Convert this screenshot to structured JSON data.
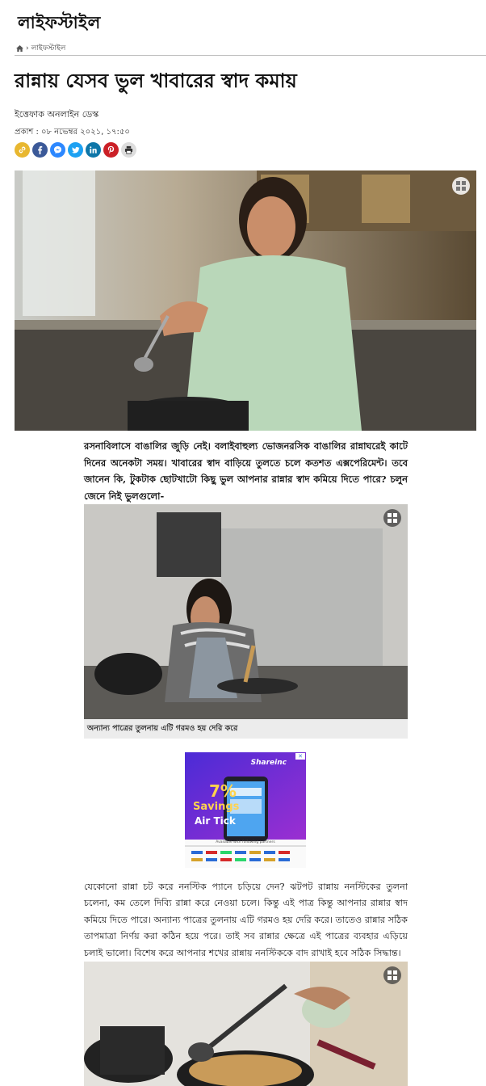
{
  "section": {
    "title": "লাইফস্টাইল"
  },
  "breadcrumb": {
    "label": "লাইফস্টাইল"
  },
  "article": {
    "headline": "রান্নায় যেসব ভুল খাবারের স্বাদ কমায়",
    "author": "ইত্তেফাক অনলাইন ডেস্ক",
    "published": "প্রকাশ : ০৮ নভেম্বর ২০২১, ১৭:৫০",
    "intro": "রসনাবিলাসে বাঙালির জুড়ি নেই। বলাইবাহুল্য ভোজনরসিক বাঙালির রান্নাঘরেই কাটে দিনের অনেকটা সময়। খাবারের স্বাদ বাড়িয়ে তুলতে চলে কতশত এক্সপেরিমেন্ট। তবে জানেন কি, টুকটাক ছোটখাটো কিছু ভুল আপনার রান্নার স্বাদ কমিয়ে দিতে পারে? চলুন জেনে নিই ভুলগুলো-",
    "image_caption": "অন্যান্য পাত্রের তুলনায় এটি গরমও হয় দেরি করে",
    "paragraph": "যেকোনো রান্না চট করে ননস্টিক প্যানে চড়িয়ে দেন? ঝটপট রান্নায় ননস্টিকের তুলনা চলেনা, কম তেলে দিব্যি রান্না করে নেওয়া চলে। কিন্তু এই পাত্র কিন্তু আপনার রান্নার স্বাদ কমিয়ে দিতে পারে। অন্যান্য পাত্রের তুলনায় এটি গরমও হয় দেরি করে। তাতেও রান্নার সঠিক তাপমাত্রা নির্ণয় করা কঠিন হয়ে পরে। তাই সব রান্নার ক্ষেত্রে এই পাত্রের ব্যবহার এড়িয়ে চলাই ভালো। বিশেষ করে আপনার শখের রান্নায় ননস্টিককে বাদ রাখাই হবে সঠিক সিদ্ধান্ত।"
  },
  "share": {
    "buttons": [
      {
        "name": "copy-link-icon",
        "color": "#e8b730"
      },
      {
        "name": "facebook-icon",
        "color": "#3b5998"
      },
      {
        "name": "messenger-icon",
        "color": "#2d88ff"
      },
      {
        "name": "twitter-icon",
        "color": "#1da1f2"
      },
      {
        "name": "linkedin-icon",
        "color": "#0e76a8"
      },
      {
        "name": "pinterest-icon",
        "color": "#cb2027"
      },
      {
        "name": "print-icon",
        "color": "#dddddd"
      }
    ]
  },
  "ad": {
    "brand": "Shareinc",
    "discount": "7%",
    "line1": "Savings",
    "line2": "Air Tick",
    "footer": "Available with following partners"
  }
}
